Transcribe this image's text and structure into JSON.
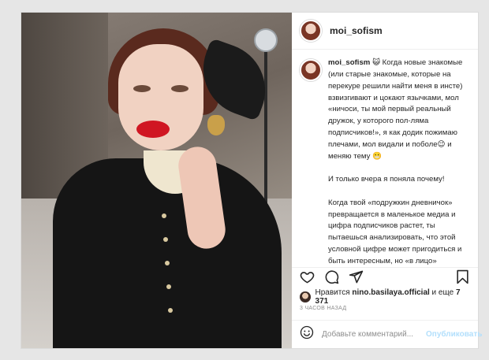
{
  "post": {
    "username": "moi_sofism",
    "caption": {
      "username": "moi_sofism",
      "paragraphs": [
        "😺 Когда новые знакомые (или старые знакомые, которые на перекуре решили найти меня в инсте) взвизгивают и цокают язычками, мол «ничоси, ты мой первый реальный дружок, у которого пол-ляма подписчиков!», я как додик пожимаю плечами, мол видали и поболе😉 и меняю тему 😬",
        "И только вчера я поняла почему!",
        "Когда твой «подружкин дневничок» превращается в маленькое медиа и цифра подписчиков растет, ты пытаешься анализировать, что этой условной цифре может пригодиться и быть интересным, но «в лицо»"
      ]
    },
    "likes": {
      "prefix": "Нравится ",
      "user": "nino.basilaya.official",
      "middle": " и еще ",
      "count": "7 371"
    },
    "timestamp": "3 ЧАСОВ НАЗАД",
    "comment": {
      "placeholder": "Добавьте комментарий...",
      "post_label": "Опубликовать"
    }
  },
  "icons": {
    "like": "heart-icon",
    "comment": "comment-icon",
    "share": "share-icon",
    "save": "bookmark-icon",
    "emoji": "emoji-icon"
  },
  "colors": {
    "text": "#262626",
    "muted": "#8e8e8e",
    "border": "#dbdbdb",
    "post_button": "#b2dffc"
  }
}
